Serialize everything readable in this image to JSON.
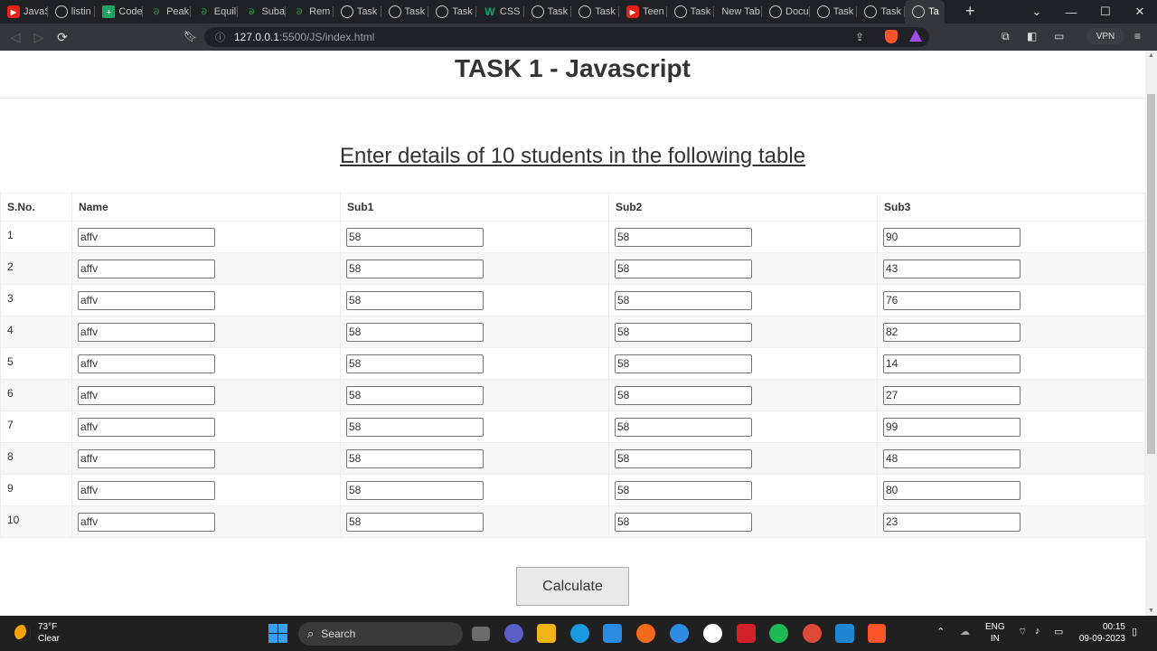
{
  "browser": {
    "tabs": [
      {
        "label": "JavaS",
        "icon": "youtube-icon"
      },
      {
        "label": "listin",
        "icon": "globe-icon"
      },
      {
        "label": "Code",
        "icon": "sheets-icon"
      },
      {
        "label": "Peak",
        "icon": "gfg-icon"
      },
      {
        "label": "Equil",
        "icon": "gfg-icon"
      },
      {
        "label": "Suba",
        "icon": "gfg-icon"
      },
      {
        "label": "Rem",
        "icon": "gfg-icon"
      },
      {
        "label": "Task",
        "icon": "globe-icon"
      },
      {
        "label": "Task",
        "icon": "globe-icon"
      },
      {
        "label": "Task",
        "icon": "globe-icon"
      },
      {
        "label": "CSS I",
        "icon": "w3schools-icon"
      },
      {
        "label": "Task",
        "icon": "globe-icon"
      },
      {
        "label": "Task",
        "icon": "globe-icon"
      },
      {
        "label": "Teen",
        "icon": "youtube-icon"
      },
      {
        "label": "Task",
        "icon": "globe-icon"
      },
      {
        "label": "New Tab",
        "icon": ""
      },
      {
        "label": "Docu",
        "icon": "globe-icon"
      },
      {
        "label": "Task",
        "icon": "globe-icon"
      },
      {
        "label": "Task",
        "icon": "globe-icon"
      },
      {
        "label": "Ta",
        "icon": "globe-icon"
      }
    ],
    "url_host": "127.0.0.1",
    "url_path": ":5500/JS/index.html",
    "vpn_label": "VPN"
  },
  "page": {
    "title": "TASK 1 - Javascript",
    "subtitle": "Enter details of 10 students in the following table",
    "columns": [
      "S.No.",
      "Name",
      "Sub1",
      "Sub2",
      "Sub3"
    ],
    "rows": [
      {
        "sno": "1",
        "name": "affv",
        "sub1": "58",
        "sub2": "58",
        "sub3": "90"
      },
      {
        "sno": "2",
        "name": "affv",
        "sub1": "58",
        "sub2": "58",
        "sub3": "43"
      },
      {
        "sno": "3",
        "name": "affv",
        "sub1": "58",
        "sub2": "58",
        "sub3": "76"
      },
      {
        "sno": "4",
        "name": "affv",
        "sub1": "58",
        "sub2": "58",
        "sub3": "82"
      },
      {
        "sno": "5",
        "name": "affv",
        "sub1": "58",
        "sub2": "58",
        "sub3": "14"
      },
      {
        "sno": "6",
        "name": "affv",
        "sub1": "58",
        "sub2": "58",
        "sub3": "27"
      },
      {
        "sno": "7",
        "name": "affv",
        "sub1": "58",
        "sub2": "58",
        "sub3": "99"
      },
      {
        "sno": "8",
        "name": "affv",
        "sub1": "58",
        "sub2": "58",
        "sub3": "48"
      },
      {
        "sno": "9",
        "name": "affv",
        "sub1": "58",
        "sub2": "58",
        "sub3": "80"
      },
      {
        "sno": "10",
        "name": "affv",
        "sub1": "58",
        "sub2": "58",
        "sub3": "23"
      }
    ],
    "calculate_label": "Calculate"
  },
  "taskbar": {
    "weather_temp": "73°F",
    "weather_desc": "Clear",
    "search_label": "Search",
    "lang_top": "ENG",
    "lang_bottom": "IN",
    "time": "00:15",
    "date": "09-09-2023"
  }
}
